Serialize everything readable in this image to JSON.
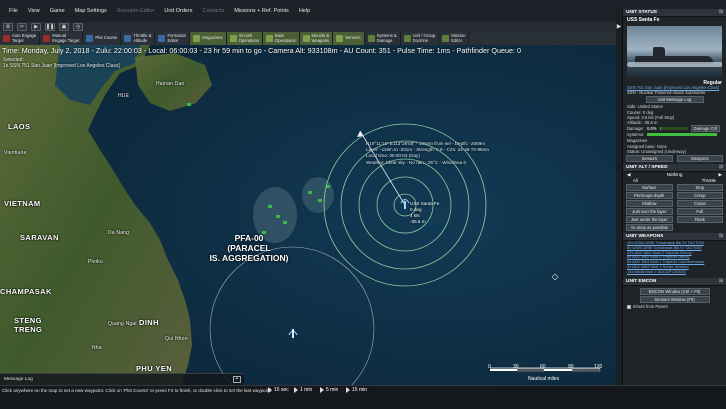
{
  "menu": {
    "items": [
      "File",
      "View",
      "Game",
      "Map Settings",
      "Scenario Editor",
      "Unit Orders",
      "Contacts",
      "Missions + Ref. Points",
      "Help"
    ],
    "disabled": [
      false,
      false,
      false,
      false,
      true,
      false,
      true,
      false,
      false
    ]
  },
  "quickbar": {
    "icons": [
      "gear-icon",
      "scissors-icon",
      "play-icon",
      "pause-icon",
      "camera-icon",
      "clock-icon"
    ]
  },
  "commands": [
    {
      "label": "Auto Engage\nTarget",
      "style": "red",
      "icon": "target-icon"
    },
    {
      "label": "Manual\nEngage Target",
      "style": "red",
      "icon": "crosshair-icon"
    },
    {
      "label": "Plot Course",
      "style": "blue",
      "icon": "waypoint-icon"
    },
    {
      "label": "Throttle &\nAltitude",
      "style": "olive",
      "icon": "throttle-icon"
    },
    {
      "label": "Formation\nEditor",
      "style": "olive",
      "icon": "formation-icon"
    },
    {
      "label": "Magazines",
      "style": "green",
      "icon": "magazine-icon"
    },
    {
      "label": "Aircraft\nOperations",
      "style": "green",
      "icon": "aircraft-icon"
    },
    {
      "label": "Boat\nOperations",
      "style": "green",
      "icon": "boat-icon"
    },
    {
      "label": "Mounts &\nWeapons",
      "style": "green",
      "icon": "mount-icon"
    },
    {
      "label": "Sensors",
      "style": "green",
      "icon": "sensor-icon"
    },
    {
      "label": "Systems &\nDamage",
      "style": "olive",
      "icon": "systems-icon"
    },
    {
      "label": "Unit / Group\nDoctrine",
      "style": "olive",
      "icon": "doctrine-icon"
    },
    {
      "label": "Mission\nEditor",
      "style": "olive",
      "icon": "mission-icon"
    }
  ],
  "hud": {
    "time_line": "Time: Monday, July 2, 2018 - Zulu: 22:00:03 - Local: 06:00:03 - 23 hr 59 min to go -  Camera Alt: 933108m  - AU Count: 351 - Pulse Time: 1ms - Pathfinder Queue: 0",
    "selected_label": "Selected:",
    "selected_unit": "1x SSN 751 San Juan [Improved Los Angeles Class]"
  },
  "map_labels": [
    {
      "text": "Hainan Dao",
      "big": false
    },
    {
      "text": "HUE",
      "big": false
    },
    {
      "text": "LAOS",
      "big": true
    },
    {
      "text": "Vientiane",
      "big": false
    },
    {
      "text": "VIETNAM",
      "big": true
    },
    {
      "text": "SARAVAN",
      "big": true
    },
    {
      "text": "Da Nang",
      "big": false
    },
    {
      "text": "Pleiku",
      "big": false
    },
    {
      "text": "CHAMPASAK",
      "big": true
    },
    {
      "text": "STENG\nTRENG",
      "big": true
    },
    {
      "text": "DINH",
      "big": true
    },
    {
      "text": "Qui Nhon",
      "big": false
    },
    {
      "text": "PHU YEN",
      "big": true
    },
    {
      "text": "Quang Ngai",
      "big": false
    },
    {
      "text": "Nha",
      "big": false
    }
  ],
  "reference_point": {
    "line1": "PFA-00",
    "line2": "(PARACEL",
    "line3": "IS. AGGREGATION)"
  },
  "unit_info": {
    "line1": "N19°11'16\" E113°28'58\" - 106nm from sel - Depth: -2069m",
    "line2": "Layer: -119m to -201m - Strength: 0.6 - CZs: 24-48-72-96nm",
    "line3": "Local time: 06:00:03 (Day)",
    "line4": "Weather: Clear sky - No rain - 25°C - Wind/Sea 0"
  },
  "unit_tag": {
    "name": "USS Santa Fe",
    "heading": "0 deg",
    "speed": "4 kts",
    "depth": "-36.6 m"
  },
  "scale": {
    "ticks": [
      "0",
      "30",
      "60",
      "90",
      "120"
    ],
    "unit": "Nautical miles"
  },
  "message_log": {
    "label": "Message Log",
    "expand_icon": "plus"
  },
  "status": {
    "hint": "Click anywhere on the map to set a new waypoint. Click on 'Plot Course' or press F3 to finish, or double-click to set the last waypoint.",
    "time_compression": [
      "15 sec",
      "1 min",
      "5 min",
      "15 min"
    ]
  },
  "panel": {
    "unit_status_title": "UNIT STATUS",
    "unit_name": "USS Santa Fe",
    "proficiency": "Regular",
    "class_link": "SSN 751 San Juan [Improved Los Angeles Class]",
    "type": "SSN - Nuclear Powered Attack Submarine",
    "message_log_btn": "Unit Message Log",
    "side": "Side: United States",
    "course": "Course: 0 deg",
    "speed": "Speed: 3.8 kts (Full Stop)",
    "altitude": "Altitude: -36.6 m",
    "damage_label": "Damage:",
    "damage_value": "0.0%",
    "damage_fraction": 0.0,
    "damage_ctrl": "Damage Ctrl",
    "systems_label": "Systems:",
    "systems_fraction": 1.0,
    "magazines": "Magazines",
    "assigned_base": "Assigned base: None",
    "status": "Status: Unassigned (Underway)",
    "sensors_btn": "Sensors",
    "weapons_btn": "Weapons",
    "alt_speed_title": "UNIT ALT / SPEED",
    "speed_all": "All",
    "speed_mode": "Nothing",
    "throttle": "Throttle",
    "alt_buttons": [
      "Surface",
      "Stop",
      "Periscope depth",
      "Creep",
      "Shallow",
      "Cruise",
      "Just over the layer",
      "Full",
      "Just under the layer",
      "Flank",
      "As deep as possible",
      ""
    ],
    "weapons_title": "UNIT WEAPONS",
    "weapons": [
      "10x UGM-109E Tomahawk Blk IV TACTOM",
      "8x UGM-109E Tomahawk Blk IV TACTOM",
      "22x ADC Mk2 Mod 0 Torpedo Decoy",
      "8x ADC Mk2 Mod 0 Torpedo Decoy",
      "6x ADC Mk3 Mod 1 Torpedo Countermeasu",
      "4x ADC Mk3 Mod 1 Sonar Jammer",
      "14x Mk48 Mod 7 ADCAP CBASS"
    ],
    "emcon_title": "UNIT EMCON",
    "emcon_btn1": "EMCON Window (Ctrl + F9)",
    "emcon_btn2": "Sensors Window (F9)",
    "obey_emcon": "Obey EMCON",
    "inherit_parent": "Inherit from Parent"
  },
  "colors": {
    "background": "#0c1e2a",
    "panel": "#1f2429",
    "link": "#6fa9e6",
    "range_ring": "#7fbf8f",
    "friendly": "#9fd3ff"
  }
}
